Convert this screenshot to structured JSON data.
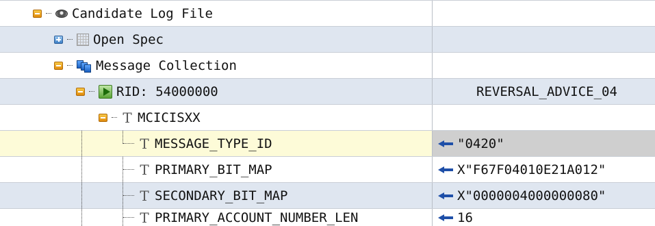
{
  "rows": [
    {
      "label": "Candidate Log File",
      "value": ""
    },
    {
      "label": "Open Spec",
      "value": ""
    },
    {
      "label": "Message Collection",
      "value": ""
    },
    {
      "label": "RID: 54000000",
      "value": "REVERSAL_ADVICE_04"
    },
    {
      "label": "MCICISXX",
      "value": ""
    },
    {
      "label": "MESSAGE_TYPE_ID",
      "value": "\"0420\""
    },
    {
      "label": "PRIMARY_BIT_MAP",
      "value": "X\"F67F04010E21A012\""
    },
    {
      "label": "SECONDARY_BIT_MAP",
      "value": "X\"0000004000000080\""
    },
    {
      "label": "PRIMARY_ACCOUNT_NUMBER_LEN",
      "value": "16"
    }
  ],
  "icons": {
    "root": "disk-icon",
    "open_spec": "grid-icon",
    "collection": "messages-icon",
    "record": "play-icon",
    "field": "text-field-icon",
    "value_pointer": "arrow-left-icon"
  },
  "colors": {
    "alt_row": "#dfe6f0",
    "selected_row": "#fdfbd8",
    "selected_value_cell": "#cfcfcf",
    "expander": "#e08a0c",
    "arrow": "#1e4fa8"
  }
}
